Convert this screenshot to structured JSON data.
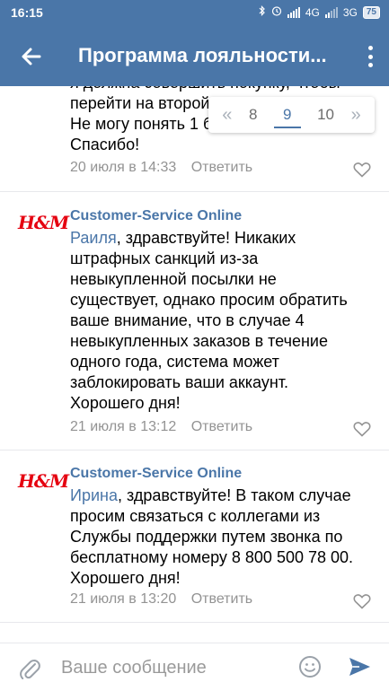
{
  "status": {
    "time": "16:15",
    "network1": "4G",
    "network2": "3G",
    "battery": "75"
  },
  "header": {
    "title": "Программа лояльности..."
  },
  "pager": {
    "prev": "«",
    "pages": [
      "8",
      "9",
      "10"
    ],
    "active": "9",
    "next": "»"
  },
  "first": {
    "lines": [
      "я должна совершить покупку, чтобы",
      "перейти на второй",
      "Не могу понять 1 б",
      "Спасибо!"
    ],
    "date": "20 июля в 14:33",
    "reply": "Ответить"
  },
  "comments": [
    {
      "logo": "H&M",
      "author": "Customer-Service Online",
      "mention": "Раиля",
      "text": ", здравствуйте! Никаких штрафных санкций из-за невыкупленной посылки не существует, однако просим обратить ваше внимание, что в случае 4 невыкупленных заказов в течение одного года, система может заблокировать ваши аккаунт. Хорошего дня!",
      "date": "21 июля в 13:12",
      "reply": "Ответить"
    },
    {
      "logo": "H&M",
      "author": "Customer-Service Online",
      "mention": "Ирина",
      "text": ", здравствуйте! В таком случае просим связаться с коллегами из Службы поддержки путем звонка по бесплатному номеру 8 800 500 78 00. Хорошего дня!",
      "date": "21 июля в 13:20",
      "reply": "Ответить"
    }
  ],
  "composer": {
    "placeholder": "Ваше сообщение"
  },
  "colors": {
    "brand": "#4a76a8",
    "hm_red": "#e50010",
    "meta_gray": "#939393"
  },
  "icons": [
    "back-arrow-icon",
    "more-vertical-icon",
    "heart-icon",
    "paperclip-icon",
    "smile-icon",
    "send-icon",
    "bluetooth-icon",
    "alarm-icon",
    "signal-icon",
    "battery-icon"
  ]
}
